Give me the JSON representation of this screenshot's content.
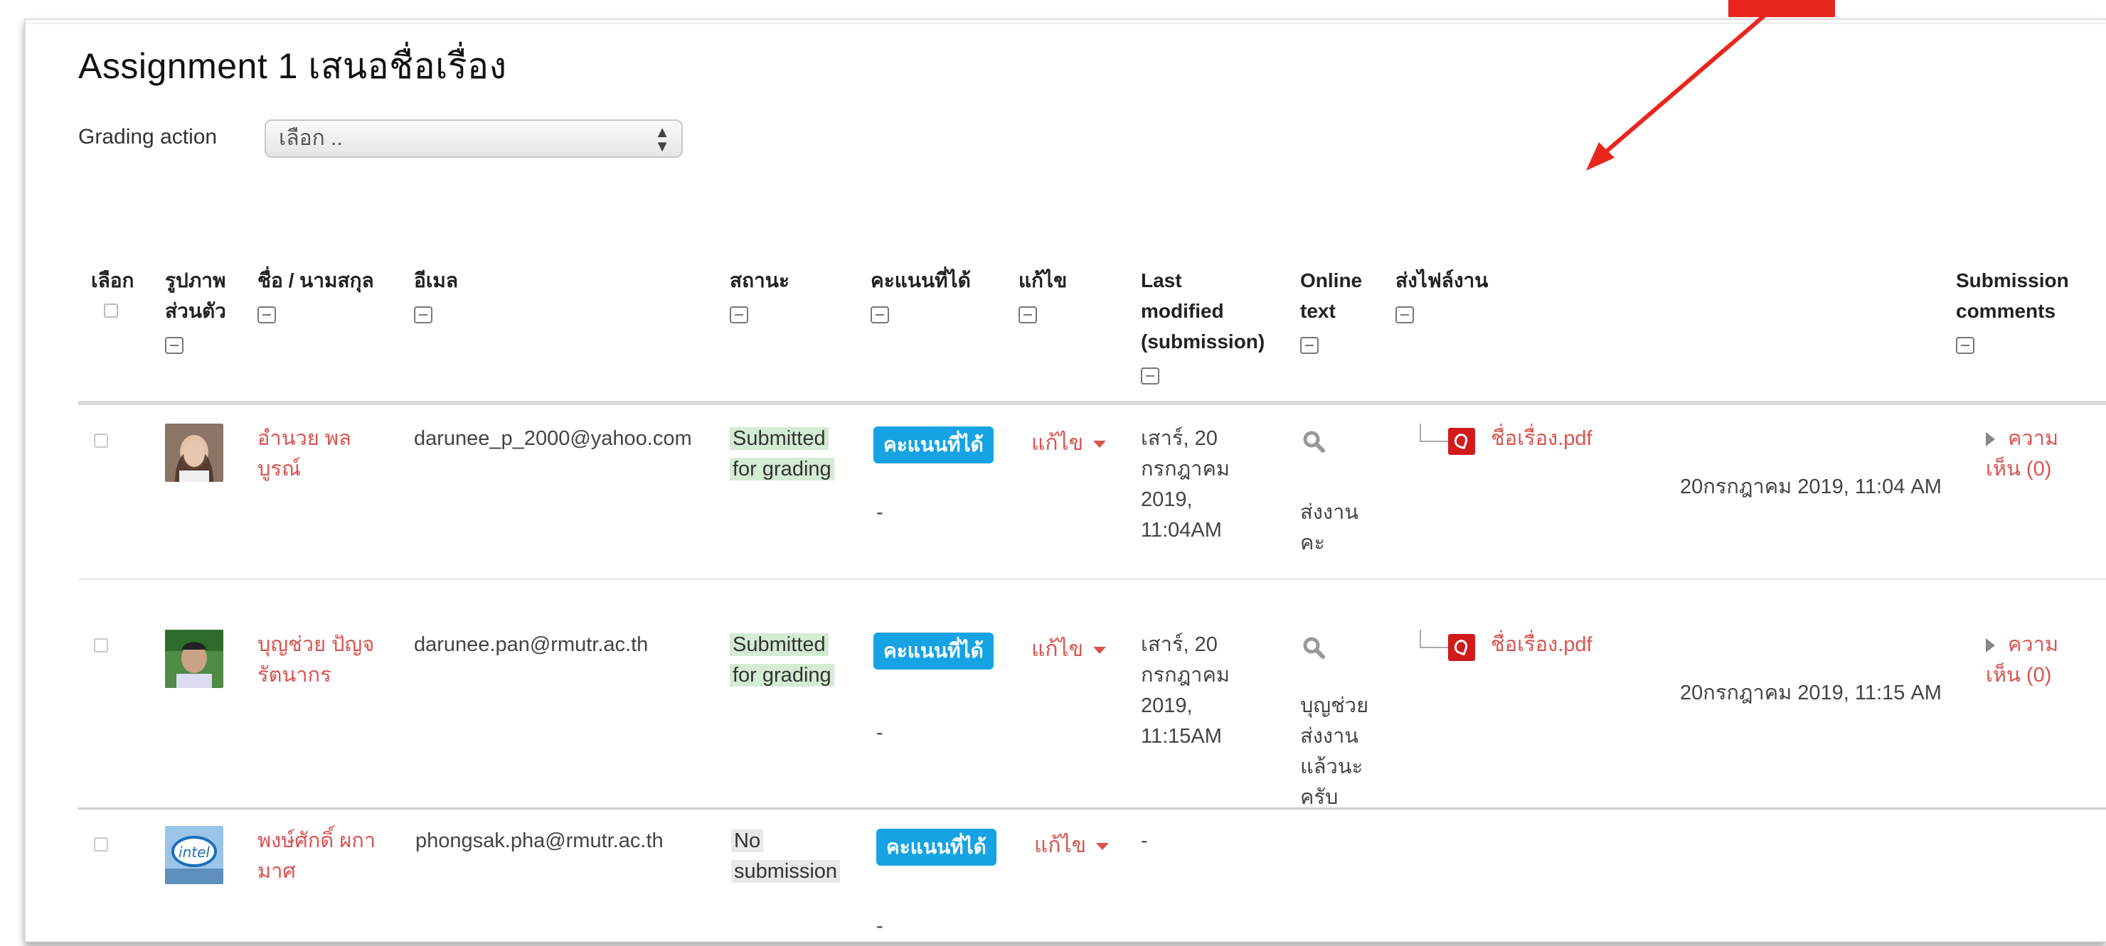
{
  "page": {
    "title": "Assignment 1 เสนอชื่อเรื่อง",
    "grading_action_label": "Grading action",
    "grading_action_selected": "เลือก .."
  },
  "columns": {
    "select": "เลือก",
    "picture_line1": "รูปภาพ",
    "picture_line2": "ส่วนตัว",
    "name": "ชื่อ / นามสกุล",
    "email": "อีเมล",
    "status": "สถานะ",
    "grade": "คะแนนที่ได้",
    "edit": "แก้ไข",
    "last_modified_line1": "Last",
    "last_modified_line2": "modified",
    "last_modified_line3": "(submission)",
    "online_text_line1": "Online",
    "online_text_line2": "text",
    "file_submissions": "ส่งไฟล์งาน",
    "submission_comments_line1": "Submission",
    "submission_comments_line2": "comments"
  },
  "rows": [
    {
      "name_line1": "อำนวย พล",
      "name_line2": "บูรณ์",
      "email": "darunee_p_2000@yahoo.com",
      "status_line1": "Submitted",
      "status_line2": "for grading",
      "grade_button": "คะแนนที่ได้",
      "grade_value": "-",
      "edit": "แก้ไข",
      "last_modified": [
        "เสาร์, 20",
        "กรกฎาคม",
        "2019,",
        "11:04AM"
      ],
      "online_text": [
        "ส่งงาน",
        "คะ"
      ],
      "file_name": "ชื่อเรื่อง.pdf",
      "file_date": "20กรกฎาคม 2019, 11:04 AM",
      "comments_line1": "ความ",
      "comments_line2": "เห็น (0)",
      "avatar_colors": [
        "#6b4f3a",
        "#d9b6a0"
      ]
    },
    {
      "name_line1": "บุญช่วย ปัญจ",
      "name_line2": "รัตนากร",
      "email": "darunee.pan@rmutr.ac.th",
      "status_line1": "Submitted",
      "status_line2": "for grading",
      "grade_button": "คะแนนที่ได้",
      "grade_value": "-",
      "edit": "แก้ไข",
      "last_modified": [
        "เสาร์, 20",
        "กรกฎาคม",
        "2019,",
        "11:15AM"
      ],
      "online_text": [
        "บุญช่วย",
        "ส่งงาน",
        "แล้วนะ",
        "ครับ"
      ],
      "file_name": "ชื่อเรื่อง.pdf",
      "file_date": "20กรกฎาคม 2019, 11:15 AM",
      "comments_line1": "ความ",
      "comments_line2": "เห็น (0)",
      "avatar_colors": [
        "#3f7a3a",
        "#c9a488"
      ]
    },
    {
      "name_line1": "พงษ์ศักดิ์ ผกา",
      "name_line2": "มาศ",
      "email": "phongsak.pha@rmutr.ac.th",
      "status_line1": "No",
      "status_line2": "submission",
      "grade_button": "คะแนนที่ได้",
      "grade_value": "-",
      "edit": "แก้ไข",
      "last_modified": [
        "-"
      ],
      "avatar_colors": [
        "#1d6fb8",
        "#9bc5e8"
      ]
    }
  ],
  "colors": {
    "link_red": "#d9534f",
    "grade_button_blue": "#16a3e3",
    "submitted_green_bg": "#d3ecd3",
    "no_submission_bg": "#e8e8e8",
    "annotation_arrow": "#e8261e"
  }
}
